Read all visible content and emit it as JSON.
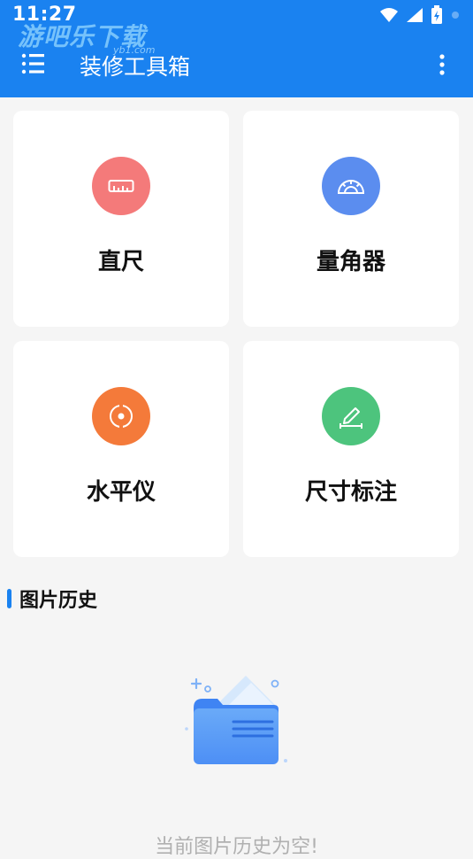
{
  "status_bar": {
    "time": "11:27"
  },
  "watermark": {
    "text": "游吧乐下载",
    "sub": "yb1.com"
  },
  "app_bar": {
    "title": "装修工具箱"
  },
  "tools": [
    {
      "label": "直尺",
      "icon": "ruler-icon",
      "color": "#f47a7a"
    },
    {
      "label": "量角器",
      "icon": "protractor-icon",
      "color": "#5b8def"
    },
    {
      "label": "水平仪",
      "icon": "level-icon",
      "color": "#f47a3a"
    },
    {
      "label": "尺寸标注",
      "icon": "dimension-pencil-icon",
      "color": "#4dc47d"
    }
  ],
  "history": {
    "title": "图片历史",
    "empty_text": "当前图片历史为空!"
  },
  "colors": {
    "primary": "#1a82f0",
    "background": "#f5f5f5",
    "card": "#ffffff"
  }
}
